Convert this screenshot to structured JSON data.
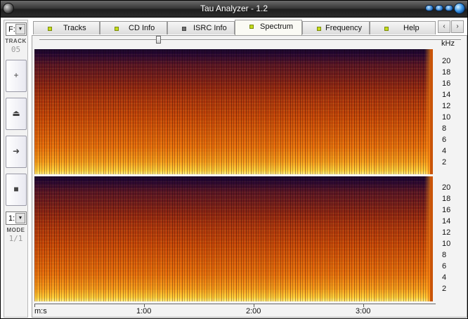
{
  "window": {
    "title": "Tau Analyzer - 1.2"
  },
  "left_panel": {
    "drive_value": "F:",
    "track_label": "TRACK",
    "track_number": "05",
    "mode_value": "1:",
    "mode_label": "MODE",
    "mode_readout": "1/1",
    "buttons": [
      {
        "icon": "plus-icon",
        "glyph": "+"
      },
      {
        "icon": "eject-icon",
        "glyph": "⏏"
      },
      {
        "icon": "play-icon",
        "glyph": "➜"
      },
      {
        "icon": "stop-icon",
        "glyph": "■"
      }
    ]
  },
  "tabs": [
    {
      "label": "Tracks",
      "led": "green",
      "active": false
    },
    {
      "label": "CD Info",
      "led": "green",
      "active": false
    },
    {
      "label": "ISRC Info",
      "led": "grey",
      "active": false
    },
    {
      "label": "Spectrum",
      "led": "green",
      "active": true
    },
    {
      "label": "Frequency",
      "led": "green",
      "active": false
    },
    {
      "label": "Help",
      "led": "green",
      "active": false
    }
  ],
  "nav": {
    "prev": "‹",
    "next": "›"
  },
  "spectrum": {
    "y_unit": "kHz",
    "y_ticks": [
      "20",
      "18",
      "16",
      "14",
      "12",
      "10",
      "8",
      "6",
      "4",
      "2"
    ],
    "x_unit": "m:s",
    "x_ticks": [
      "1:00",
      "2:00",
      "3:00"
    ],
    "slider_position": 0.28
  },
  "colors": {
    "spectrum_low": "#fff08a",
    "spectrum_mid": "#e56a0a",
    "spectrum_high": "#1a0a2e",
    "led_green": "#c4dc1a"
  }
}
